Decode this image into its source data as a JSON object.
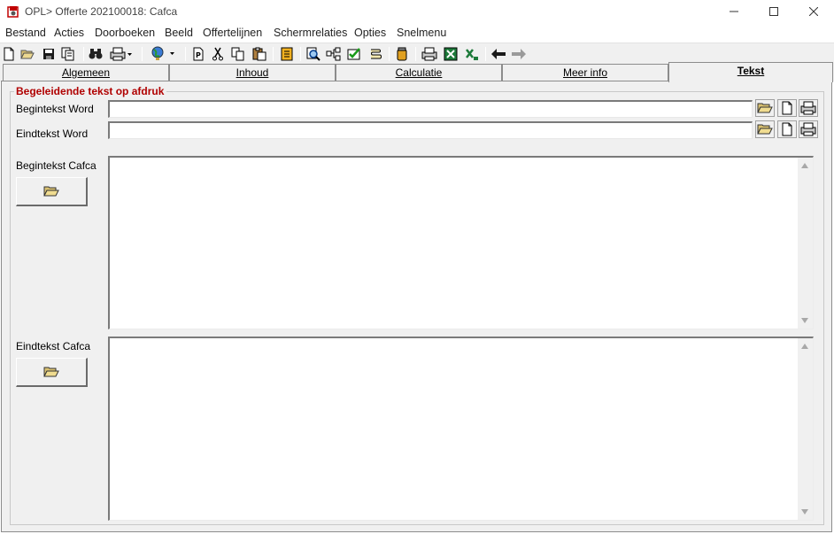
{
  "window": {
    "title": "OPL> Offerte 202100018: Cafca",
    "icon": "app-logo-icon"
  },
  "menu": [
    "Bestand",
    "Acties",
    "Doorboeken",
    "Beeld",
    "Offertelijnen",
    "Schermrelaties",
    "Opties",
    "Snelmenu"
  ],
  "toolbar": {
    "icons": [
      "new-document-icon",
      "open-folder-icon",
      "save-icon",
      "copy-document-icon",
      "binoculars-icon",
      "print-icon",
      "globe-icon",
      "paste-p-icon",
      "cut-icon",
      "copy-icon",
      "paste-icon",
      "yellow-box-icon",
      "search-document-icon",
      "tree-icon",
      "checkmark-icon",
      "scroll-icon",
      "jar-icon",
      "printer-icon",
      "excel-icon",
      "excel-export-icon",
      "back-arrow-icon",
      "forward-arrow-icon"
    ]
  },
  "tabs": [
    {
      "label": "Algemeen",
      "active": false
    },
    {
      "label": "Inhoud",
      "active": false
    },
    {
      "label": "Calculatie",
      "active": false
    },
    {
      "label": "Meer info",
      "active": false
    },
    {
      "label": "Tekst",
      "active": true
    }
  ],
  "group": {
    "title": "Begeleidende tekst op afdruk",
    "title_color": "#b00000"
  },
  "fields": {
    "begintekst_word": {
      "label": "Begintekst Word",
      "value": ""
    },
    "eindtekst_word": {
      "label": "Eindtekst Word",
      "value": ""
    },
    "begintekst_cafca": {
      "label": "Begintekst Cafca",
      "value": ""
    },
    "eindtekst_cafca": {
      "label": "Eindtekst Cafca",
      "value": ""
    }
  }
}
